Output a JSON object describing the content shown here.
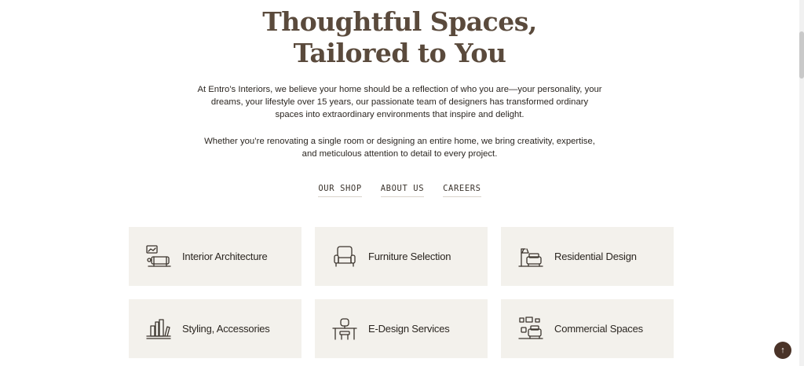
{
  "hero": {
    "title_line1": "Thoughtful Spaces,",
    "title_line2": "Tailored to You",
    "paragraph1": "At Entro’s Interiors, we believe your home should be a reflection of who you are—your personality, your dreams, your lifestyle over 15 years, our passionate team of designers has transformed ordinary spaces into extraordinary environments that inspire and delight.",
    "paragraph2": "Whether you’re renovating a single room or designing an entire home, we bring creativity, expertise, and meticulous attention to detail to every project."
  },
  "nav": {
    "links": [
      {
        "label": "OUR SHOP"
      },
      {
        "label": "ABOUT US"
      },
      {
        "label": "CAREERS"
      }
    ]
  },
  "services": [
    {
      "label": "Interior Architecture",
      "icon": "interior-architecture-icon"
    },
    {
      "label": "Furniture Selection",
      "icon": "armchair-icon"
    },
    {
      "label": "Residential Design",
      "icon": "residential-design-icon"
    },
    {
      "label": "Styling, Accessories",
      "icon": "books-shelf-icon"
    },
    {
      "label": "E-Design Services",
      "icon": "desk-chair-icon"
    },
    {
      "label": "Commercial Spaces",
      "icon": "commercial-spaces-icon"
    }
  ],
  "back_to_top": {
    "icon": "arrow-up-icon",
    "glyph": "↑"
  },
  "colors": {
    "title": "#5a4a3c",
    "card_bg": "#f3f1ec",
    "button_bg": "#4a3328"
  }
}
